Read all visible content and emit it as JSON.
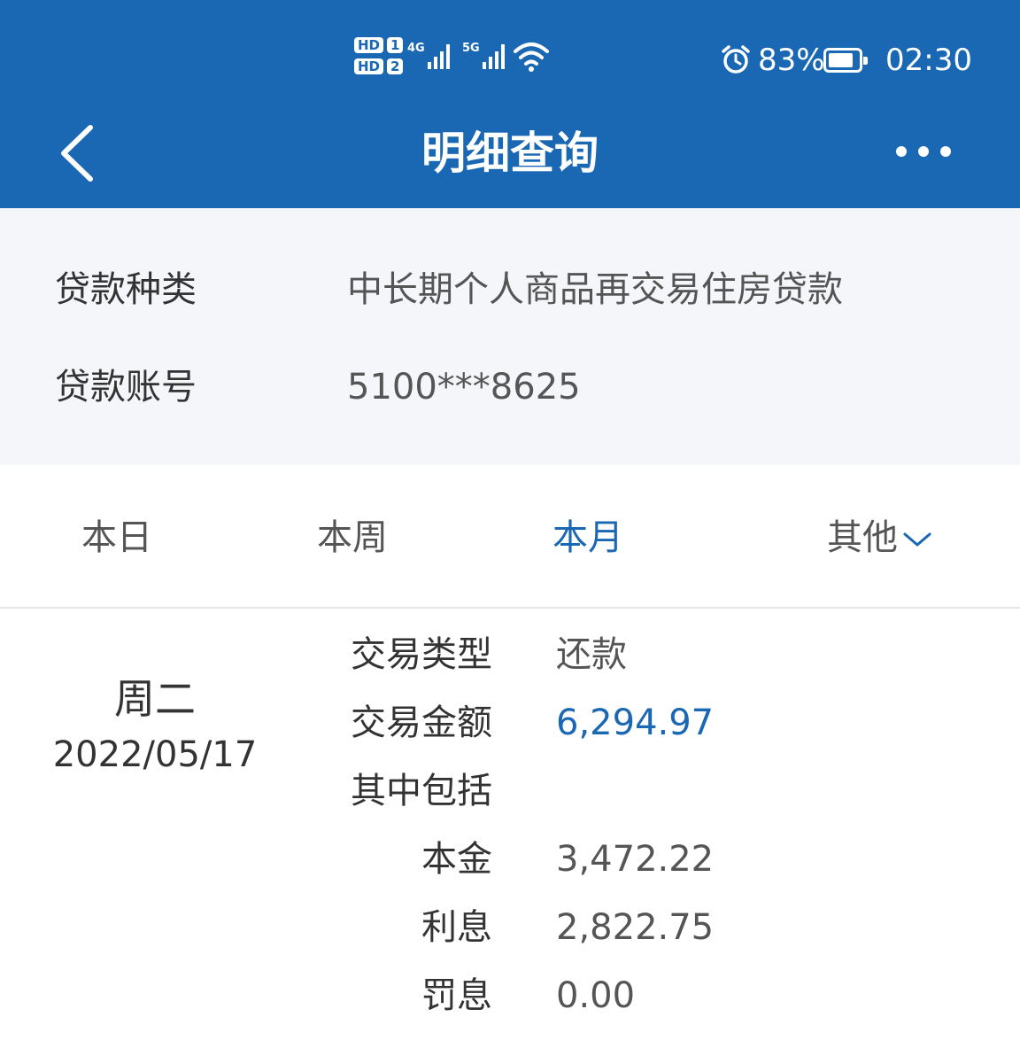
{
  "status_bar": {
    "sim1": "HD",
    "sim1_index": "1",
    "sim2": "HD",
    "sim2_index": "2",
    "net1": "4G",
    "net2": "5G",
    "battery_percent": "83%",
    "battery_level": 0.83,
    "time": "02:30",
    "icons": [
      "signal-icon",
      "wifi-icon",
      "alarm-icon",
      "battery-icon"
    ]
  },
  "header": {
    "title": "明细查询",
    "back_icon": "chevron-left-icon",
    "more_icon": "more-dots-icon"
  },
  "loan": {
    "type_label": "贷款种类",
    "type_value": "中长期个人商品再交易住房贷款",
    "account_label": "贷款账号",
    "account_value": "5100***8625"
  },
  "tabs": [
    {
      "label": "本日",
      "active": false
    },
    {
      "label": "本周",
      "active": false
    },
    {
      "label": "本月",
      "active": true
    },
    {
      "label": "其他",
      "active": false
    }
  ],
  "record": {
    "weekday": "周二",
    "date": "2022/05/17",
    "fields": [
      {
        "label": "交易类型",
        "value": "还款"
      },
      {
        "label": "交易金额",
        "value": "6,294.97"
      },
      {
        "label": "其中包括",
        "value": ""
      },
      {
        "label": "本金",
        "value": "3,472.22"
      },
      {
        "label": "利息",
        "value": "2,822.75"
      },
      {
        "label": "罚息",
        "value": "0.00"
      }
    ]
  },
  "colors": {
    "header_bg": "#1a67b3",
    "accent": "#1a67b3",
    "panel_bg": "#f4f6f9"
  }
}
